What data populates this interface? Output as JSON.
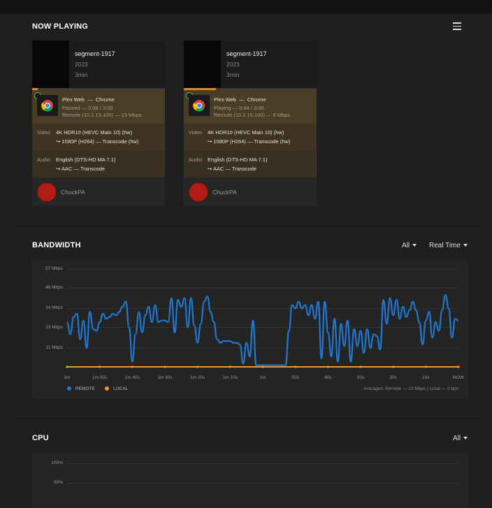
{
  "now_playing": {
    "title": "NOW PLAYING",
    "sessions": [
      {
        "title": "segment-1917",
        "year": "2023",
        "duration": "3min",
        "progress": 0.04,
        "player": "Plex Web",
        "separator": "—",
        "browser": "Chrome",
        "state": "Paused — 0:08 / 3:00",
        "location": "Remote (10.2.15.100) — 19 Mbps",
        "video_label": "Video",
        "video_src": "4K HDR10 (HEVC Main 10) (hw)",
        "video_dst": "↪ 1080P (H264) — Transcode (hw)",
        "audio_label": "Audio",
        "audio_src": "English (DTS-HD MA 7.1)",
        "audio_dst": "↪ AAC — Transcode",
        "user": "ChuckPA"
      },
      {
        "title": "segment-1917",
        "year": "2023",
        "duration": "3min",
        "progress": 0.24,
        "player": "Plex Web",
        "separator": "—",
        "browser": "Chrome",
        "state": "Playing — 0:44 / 3:00",
        "location": "Remote (10.2.15.100) — 8 Mbps",
        "video_label": "Video",
        "video_src": "4K HDR10 (HEVC Main 10) (hw)",
        "video_dst": "↪ 1080P (H264) — Transcode (hw)",
        "audio_label": "Audio",
        "audio_src": "English (DTS-HD MA 7.1)",
        "audio_dst": "↪ AAC — Transcode",
        "user": "ChuckPA"
      }
    ]
  },
  "bandwidth": {
    "title": "BANDWIDTH",
    "filter": "All",
    "range": "Real Time",
    "legend_remote": "REMOTE",
    "legend_local": "LOCAL",
    "averages": "Averages: Remote — 22 Mbps | Local — 0 bps"
  },
  "cpu": {
    "title": "CPU",
    "filter": "All",
    "ticks": [
      "100%",
      "80%"
    ]
  },
  "colors": {
    "remote": "#1f78d1",
    "local": "#e59b38",
    "accent": "#d88a2a"
  },
  "chart_data": {
    "type": "line",
    "title": "BANDWIDTH",
    "xlabel": "",
    "ylabel": "",
    "ylim": [
      0,
      57
    ],
    "y_ticks": [
      "57 Mbps",
      "46 Mbps",
      "34 Mbps",
      "23 Mbps",
      "11 Mbps"
    ],
    "y_tick_values": [
      57,
      46,
      34,
      23,
      11
    ],
    "x_ticks": [
      "2m",
      "1m 50s",
      "1m 40s",
      "1m 30s",
      "1m 20s",
      "1m 10s",
      "1m",
      "50s",
      "40s",
      "30s",
      "20s",
      "10s",
      "NOW"
    ],
    "x_seconds_ago": [
      120,
      110,
      100,
      90,
      80,
      70,
      60,
      50,
      40,
      30,
      20,
      10,
      0
    ],
    "series": [
      {
        "name": "REMOTE",
        "x": [
          120,
          119,
          118,
          117,
          116,
          115,
          114,
          113,
          112,
          111,
          110,
          109,
          108,
          107,
          106,
          105,
          104,
          103,
          102,
          101,
          100,
          99,
          98,
          97,
          96,
          95,
          94,
          93,
          92,
          91,
          90,
          89,
          88,
          87,
          86,
          85,
          84,
          83,
          82,
          81,
          80,
          79,
          78,
          77,
          76,
          75,
          74,
          73,
          72,
          71,
          70,
          69,
          68,
          67,
          66,
          65,
          64,
          63,
          62,
          61,
          60,
          59,
          58,
          57,
          56,
          55,
          54,
          53,
          52,
          51,
          50,
          49,
          48,
          47,
          46,
          45,
          44,
          43,
          42,
          41,
          40,
          39,
          38,
          37,
          36,
          35,
          34,
          33,
          32,
          31,
          30,
          29,
          28,
          27,
          26,
          25,
          24,
          23,
          22,
          21,
          20,
          19,
          18,
          17,
          16,
          15,
          14,
          13,
          12,
          11,
          10,
          9,
          8,
          7,
          6,
          5,
          4,
          3,
          2,
          1,
          0
        ],
        "values": [
          26,
          19,
          29,
          31,
          16,
          27,
          11,
          32,
          22,
          21,
          26,
          31,
          28,
          29,
          31,
          30,
          32,
          35,
          38,
          23,
          3,
          19,
          32,
          20,
          30,
          35,
          26,
          36,
          26,
          27,
          27,
          26,
          40,
          20,
          39,
          35,
          40,
          23,
          40,
          24,
          14,
          25,
          38,
          41,
          32,
          26,
          16,
          14,
          15,
          15,
          15,
          14,
          14,
          13,
          2,
          14,
          6,
          27,
          1,
          1,
          1,
          1,
          1,
          1,
          1,
          1,
          1,
          1,
          21,
          36,
          34,
          38,
          34,
          36,
          30,
          36,
          28,
          38,
          5,
          38,
          20,
          6,
          28,
          3,
          25,
          12,
          27,
          3,
          22,
          12,
          21,
          8,
          22,
          11,
          19,
          18,
          10,
          39,
          25,
          40,
          30,
          39,
          28,
          35,
          29,
          33,
          38,
          33,
          26,
          13,
          27,
          32,
          17,
          26,
          21,
          33,
          42,
          34,
          17,
          28,
          27
        ],
        "color": "#1f78d1"
      },
      {
        "name": "LOCAL",
        "x": [
          120,
          0
        ],
        "values": [
          0,
          0
        ],
        "color": "#e59b38"
      }
    ],
    "grid": true,
    "legend": "bottom-left"
  }
}
